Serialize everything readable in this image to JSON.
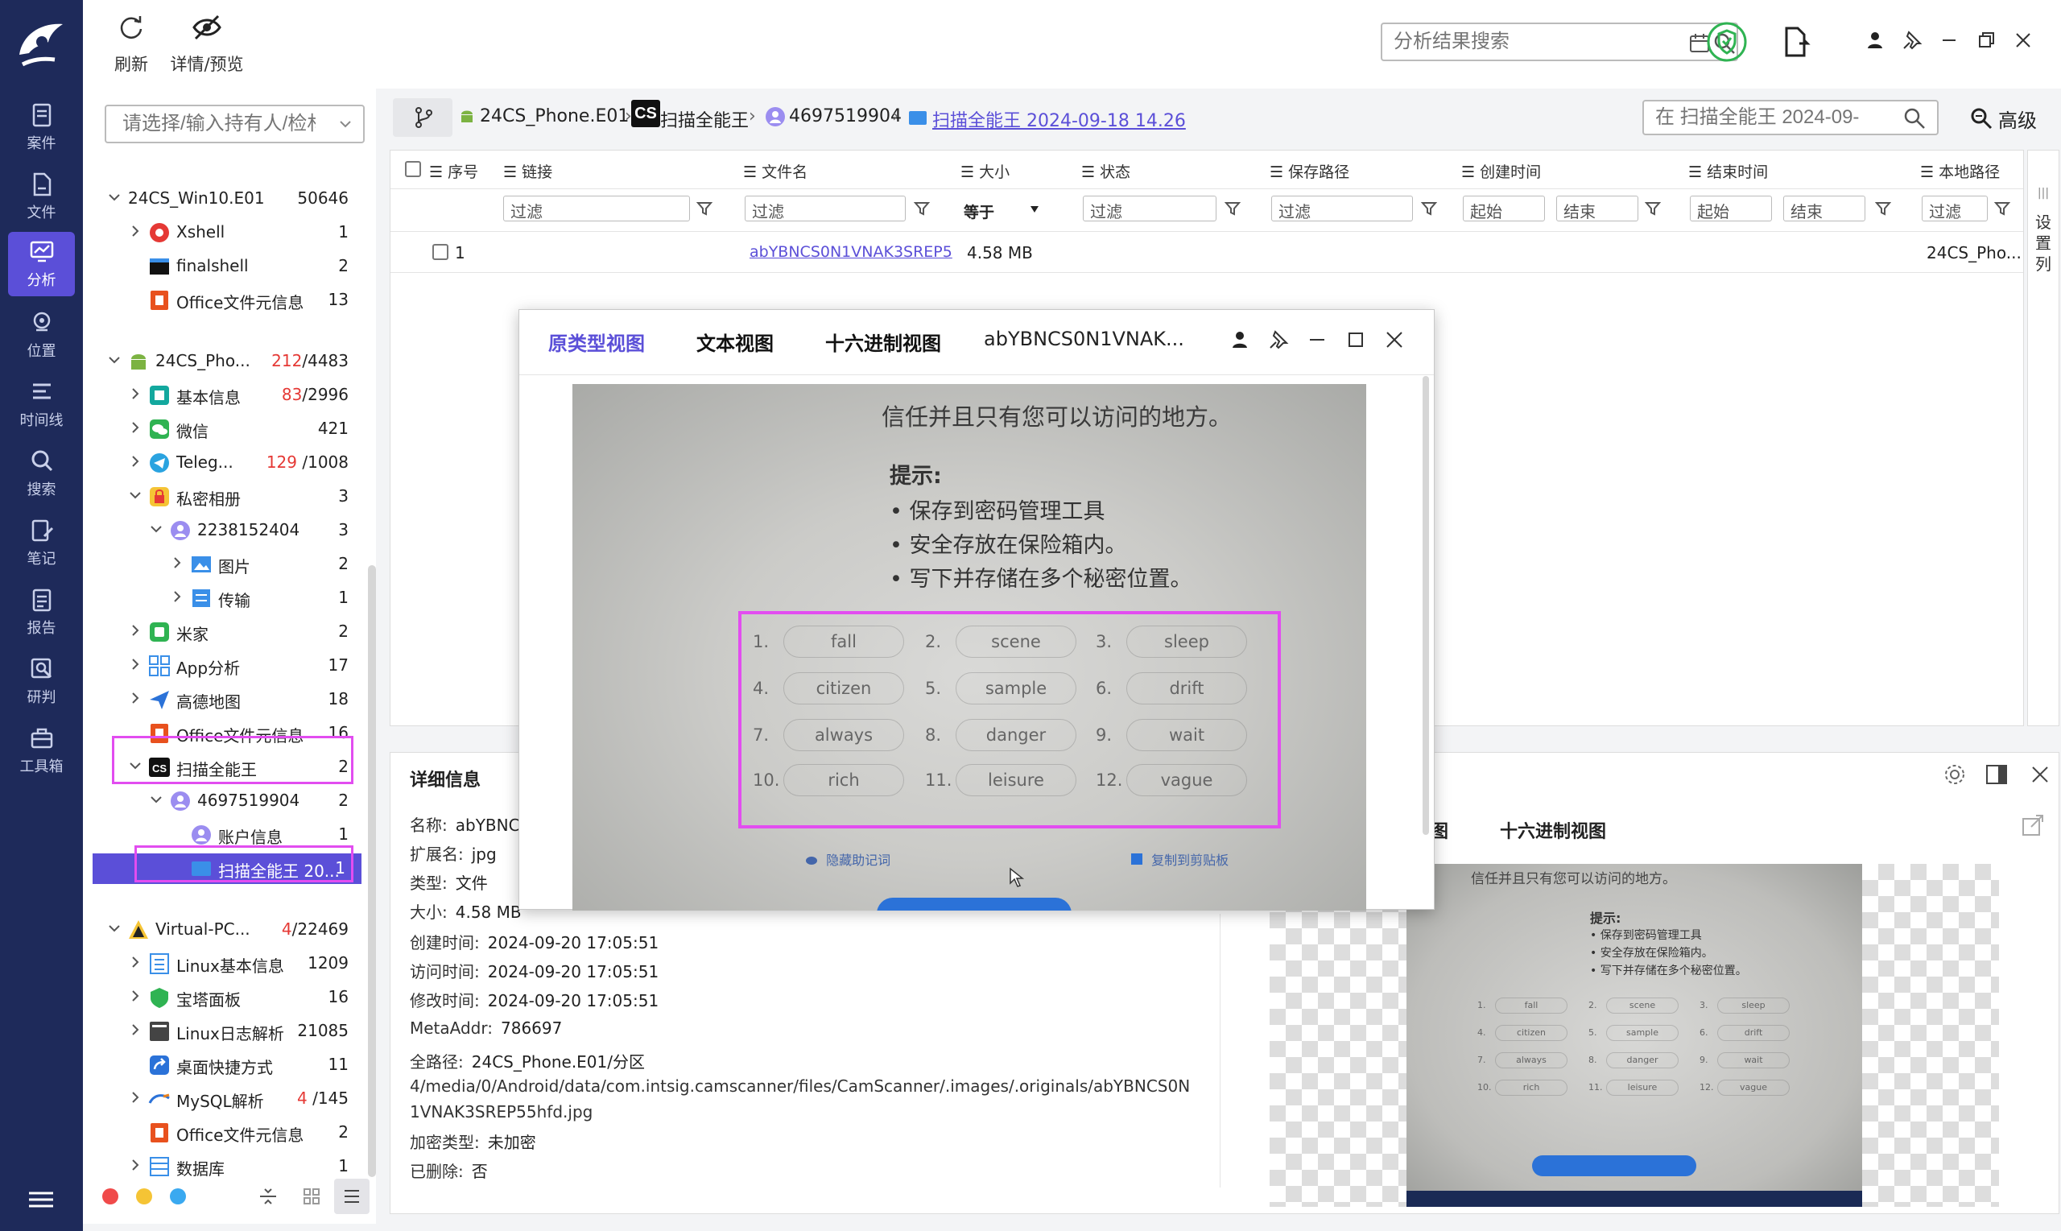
{
  "nav": {
    "items": [
      {
        "label": "案件",
        "icon": "case-icon"
      },
      {
        "label": "文件",
        "icon": "file-icon"
      },
      {
        "label": "分析",
        "icon": "analysis-icon"
      },
      {
        "label": "位置",
        "icon": "location-icon"
      },
      {
        "label": "时间线",
        "icon": "timeline-icon"
      },
      {
        "label": "搜索",
        "icon": "search-icon"
      },
      {
        "label": "笔记",
        "icon": "note-icon"
      },
      {
        "label": "报告",
        "icon": "report-icon"
      },
      {
        "label": "研判",
        "icon": "judge-icon"
      },
      {
        "label": "工具箱",
        "icon": "toolbox-icon"
      }
    ],
    "active_index": 2
  },
  "toolbar": {
    "refresh_label": "刷新",
    "detail_label": "详情/预览",
    "search_placeholder": "分析结果搜索"
  },
  "tree": {
    "search_placeholder": "请选择/输入持有人/检材",
    "rows": [
      {
        "label": "24CS_Win10.E01",
        "count": "50646",
        "red": ""
      },
      {
        "label": "Xshell",
        "count": "1",
        "red": ""
      },
      {
        "label": "finalshell",
        "count": "2",
        "red": ""
      },
      {
        "label": "Office文件元信息",
        "count": "13",
        "red": ""
      },
      {
        "label": "24CS_Pho...",
        "count": "/4483",
        "red": "212"
      },
      {
        "label": "基本信息",
        "count": "/2996",
        "red": "83"
      },
      {
        "label": "微信",
        "count": "421",
        "red": ""
      },
      {
        "label": "Teleg...",
        "count": " /1008",
        "red": "129"
      },
      {
        "label": "私密相册",
        "count": "3",
        "red": ""
      },
      {
        "label": "2238152404",
        "count": "3",
        "red": ""
      },
      {
        "label": "图片",
        "count": "2",
        "red": ""
      },
      {
        "label": "传输",
        "count": "1",
        "red": ""
      },
      {
        "label": "米家",
        "count": "2",
        "red": ""
      },
      {
        "label": "App分析",
        "count": "17",
        "red": ""
      },
      {
        "label": "高德地图",
        "count": "18",
        "red": ""
      },
      {
        "label": "Office文件元信息",
        "count": "16",
        "red": ""
      },
      {
        "label": "扫描全能王",
        "count": "2",
        "red": ""
      },
      {
        "label": "4697519904",
        "count": "2",
        "red": ""
      },
      {
        "label": "账户信息",
        "count": "1",
        "red": ""
      },
      {
        "label": "扫描全能王 20...",
        "count": "1",
        "red": ""
      },
      {
        "label": "Virtual-PC...",
        "count": "/22469",
        "red": "4"
      },
      {
        "label": "Linux基本信息",
        "count": "1209",
        "red": ""
      },
      {
        "label": "宝塔面板",
        "count": "16",
        "red": ""
      },
      {
        "label": "Linux日志解析",
        "count": "21085",
        "red": ""
      },
      {
        "label": "桌面快捷方式",
        "count": "11",
        "red": ""
      },
      {
        "label": "MySQL解析",
        "count": " /145",
        "red": "4"
      },
      {
        "label": "Office文件元信息",
        "count": "2",
        "red": ""
      },
      {
        "label": "数据库",
        "count": "1",
        "red": ""
      }
    ]
  },
  "breadcrumb": {
    "items": [
      "24CS_Phone.E01",
      "扫描全能王",
      "4697519904",
      "扫描全能王 2024-09-18 14.26"
    ],
    "search_placeholder": "在 扫描全能王 2024-09-",
    "advanced_label": "高级"
  },
  "grid": {
    "columns": [
      "序号",
      "链接",
      "文件名",
      "大小",
      "状态",
      "保存路径",
      "创建时间",
      "结束时间",
      "本地路径"
    ],
    "filter_placeholder": "过滤",
    "size_op": "等于",
    "start_label": "起始",
    "end_label": "结束",
    "rows": [
      {
        "index": "1",
        "filename": "abYBNCS0N1VNAK3SREP5",
        "size": "4.58 MB",
        "local_path": "24CS_Pho..."
      }
    ],
    "side_tab_label": "设置列"
  },
  "detail": {
    "title": "详细信息",
    "fields": [
      {
        "k": "名称:",
        "v": "abYBNC"
      },
      {
        "k": "扩展名:",
        "v": "jpg"
      },
      {
        "k": "类型:",
        "v": "文件"
      },
      {
        "k": "大小:",
        "v": "4.58 MB"
      },
      {
        "k": "创建时间:",
        "v": "2024-09-20 17:05:51"
      },
      {
        "k": "访问时间:",
        "v": "2024-09-20 17:05:51"
      },
      {
        "k": "修改时间:",
        "v": "2024-09-20 17:05:51"
      },
      {
        "k": "MetaAddr:",
        "v": "786697"
      },
      {
        "k": "全路径:",
        "v": "24CS_Phone.E01/分区"
      }
    ],
    "path_line2": "4/media/0/Android/data/com.intsig.camscanner/files/CamScanner/.images/.originals/abYBNCS0N",
    "path_line3": "1VNAK3SREP55hfd.jpg",
    "encrypt_label": "加密类型:",
    "encrypt_value": "未加密",
    "deleted_label": "已删除:",
    "deleted_value": "否",
    "preview_tab_a": "图",
    "preview_tab_b": "十六进制视图"
  },
  "viewer": {
    "tabs": [
      "原类型视图",
      "文本视图",
      "十六进制视图"
    ],
    "title": "abYBNCS0N1VNAK...",
    "photo": {
      "top_line": "信任并且只有您可以访问的地方。",
      "hint_title": "提示:",
      "hints": [
        "• 保存到密码管理工具",
        "• 安全存放在保险箱内。",
        "• 写下并存储在多个秘密位置。"
      ],
      "words": [
        {
          "n": "1.",
          "w": "fall"
        },
        {
          "n": "2.",
          "w": "scene"
        },
        {
          "n": "3.",
          "w": "sleep"
        },
        {
          "n": "4.",
          "w": "citizen"
        },
        {
          "n": "5.",
          "w": "sample"
        },
        {
          "n": "6.",
          "w": "drift"
        },
        {
          "n": "7.",
          "w": "always"
        },
        {
          "n": "8.",
          "w": "danger"
        },
        {
          "n": "9.",
          "w": "wait"
        },
        {
          "n": "10.",
          "w": "rich"
        },
        {
          "n": "11.",
          "w": "leisure"
        },
        {
          "n": "12.",
          "w": "vague"
        }
      ],
      "hide_label": "隐藏助记词",
      "copy_label": "复制到剪贴板"
    }
  },
  "colors": {
    "accent": "#5b4fd8",
    "highlight": "#e24df0",
    "nav_bg": "#1e2a5a",
    "red": "#e53935"
  }
}
